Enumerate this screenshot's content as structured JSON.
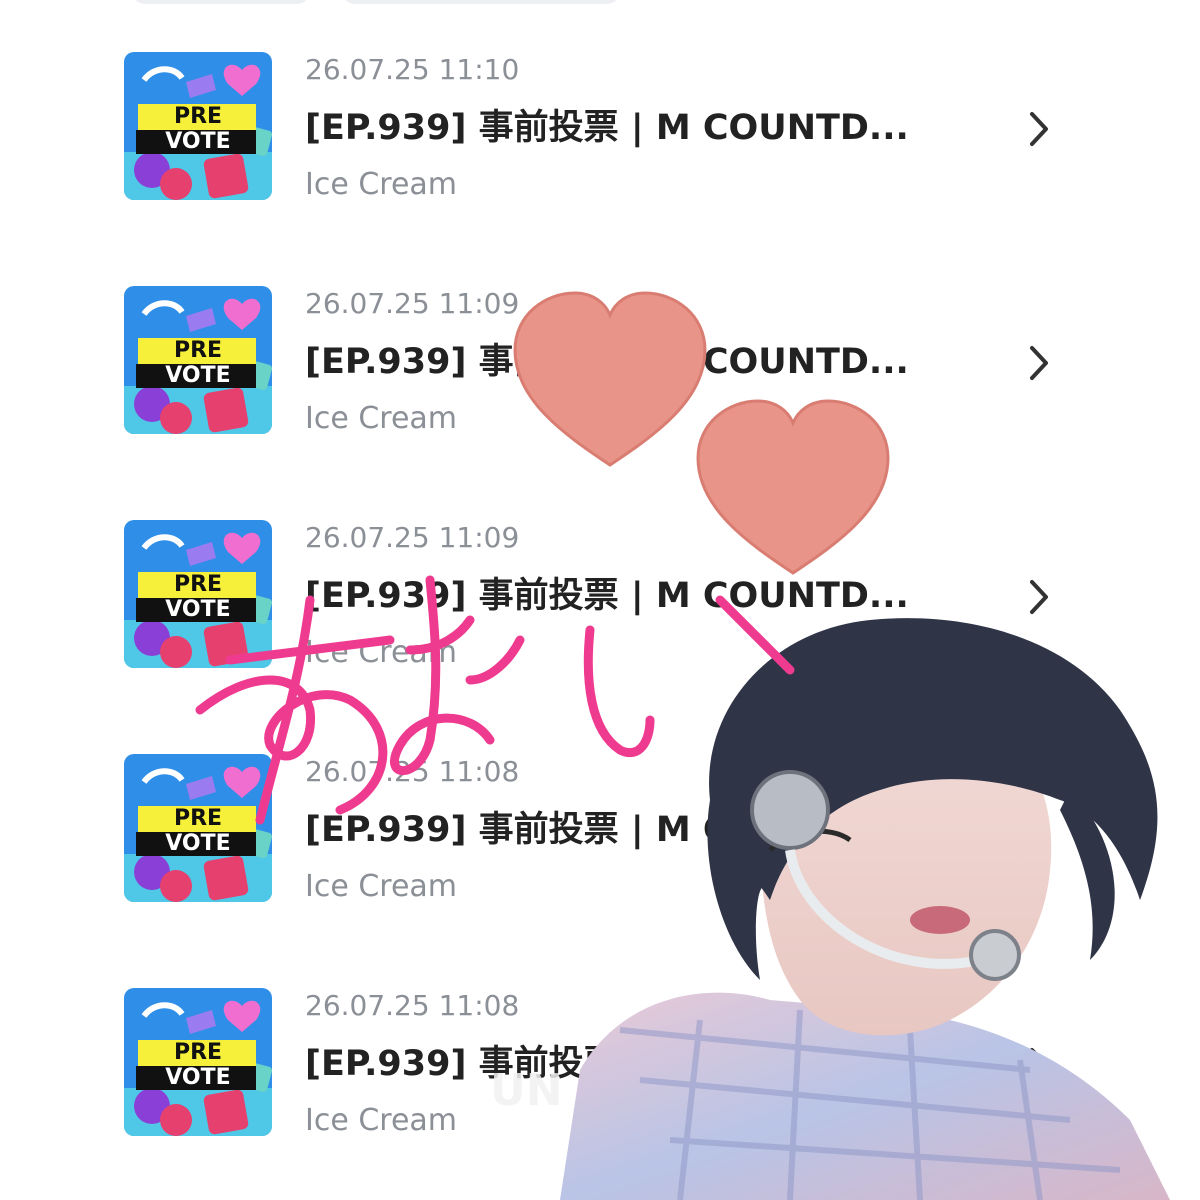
{
  "items": [
    {
      "timestamp": "26.07.25 11:10",
      "title": "[EP.939] 事前投票 | M COUNTD...",
      "subtitle": "Ice Cream",
      "badge_top": "PRE",
      "badge_bottom": "VOTE"
    },
    {
      "timestamp": "26.07.25 11:09",
      "title": "[EP.939] 事前投票 | M COUNTD...",
      "subtitle": "Ice Cream",
      "badge_top": "PRE",
      "badge_bottom": "VOTE"
    },
    {
      "timestamp": "26.07.25 11:09",
      "title": "[EP.939] 事前投票 | M COUNTD...",
      "subtitle": "Ice Cream",
      "badge_top": "PRE",
      "badge_bottom": "VOTE"
    },
    {
      "timestamp": "26.07.25 11:08",
      "title": "[EP.939] 事前投票 | M COUNTD...",
      "subtitle": "Ice Cream",
      "badge_top": "PRE",
      "badge_bottom": "VOTE"
    },
    {
      "timestamp": "26.07.25 11:08",
      "title": "[EP.939] 事前投票 | M COUNTD...",
      "subtitle": "Ice Cream",
      "badge_top": "PRE",
      "badge_bottom": "VOTE"
    }
  ],
  "colors": {
    "accent_pink": "#ef3b8f",
    "heart": "#e89488",
    "thumb_bg": "#2f8fe8",
    "badge_yellow": "#f6f03a"
  },
  "overlay": {
    "handwriting": "ねむい",
    "photo_text": "UN"
  }
}
